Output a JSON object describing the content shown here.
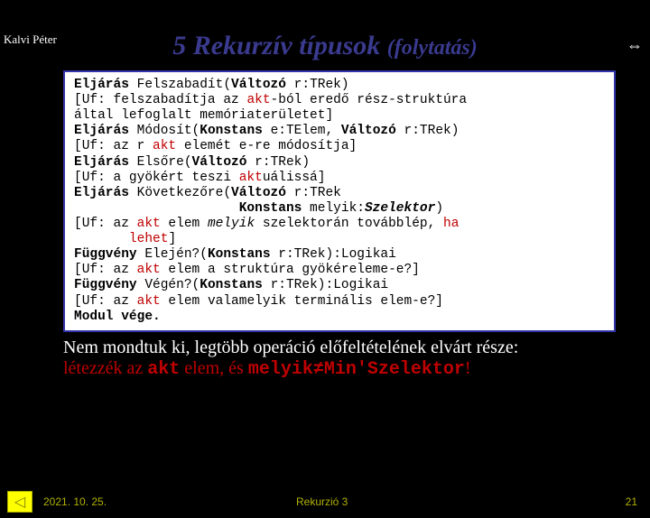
{
  "topLeft": "Kalvi Péter",
  "title_main": "5 Rekurzív típusok ",
  "title_cont": "(folytatás)",
  "code": {
    "l1a": "Eljárás",
    "l1b": " Felszabadít(",
    "l1c": "Változó",
    "l1d": " r:TRek)",
    "l2a": " [Uf: felszabadítja az ",
    "l2b": "akt",
    "l2c": "-ból eredő rész-struktúra",
    "l3": "       által lefoglalt memóriaterületet]",
    "l4a": "Eljárás",
    "l4b": " Módosít(",
    "l4c": "Konstans",
    "l4d": " e:TElem, ",
    "l4e": "Változó",
    "l4f": " r:TRek)",
    "l5a": " [Uf: az r ",
    "l5b": "akt",
    "l5c": " elemét e-re módosítja]",
    "l6a": "Eljárás",
    "l6b": " Elsőre(",
    "l6c": "Változó",
    "l6d": " r:TRek)",
    "l7a": " [Uf: a gyökért teszi ",
    "l7b": "akt",
    "l7c": "uálissá]",
    "l8a": "Eljárás",
    "l8b": " Következőre(",
    "l8c": "Változó",
    "l8d": " r:TRek",
    "l9a": "                     ",
    "l9b": "Konstans",
    "l9c": " melyik:",
    "l9d": "Szelektor",
    "l9e": ")",
    "l10a": " [Uf: az ",
    "l10b": "akt",
    "l10c": " elem ",
    "l10d": "melyik",
    "l10e": " szelektorán továbblép, ",
    "l10f": "ha",
    "l11a": "       ",
    "l11b": "lehet",
    "l11c": "]",
    "l12a": "Függvény",
    "l12b": " Elején?(",
    "l12c": "Konstans",
    "l12d": " r:TRek):Logikai",
    "l13a": " [Uf: az ",
    "l13b": "akt",
    "l13c": " elem a struktúra gyökéreleme-e?]",
    "l14a": "Függvény",
    "l14b": " Végén?(",
    "l14c": "Konstans",
    "l14d": " r:TRek):Logikai",
    "l15a": " [Uf: az ",
    "l15b": "akt",
    "l15c": " elem valamelyik terminális elem-e?]",
    "l16": "Modul vége."
  },
  "note1": "Nem mondtuk ki, legtöbb operáció előfeltételének elvárt része:",
  "note2a": "létezzék az ",
  "note2b": "akt",
  "note2c": " elem, és ",
  "note2d": "melyik≠Min'Szelektor",
  "note2e": "!",
  "footer": {
    "date": "2021. 10. 25.",
    "mid": "Rekurzió 3",
    "page": "21"
  }
}
